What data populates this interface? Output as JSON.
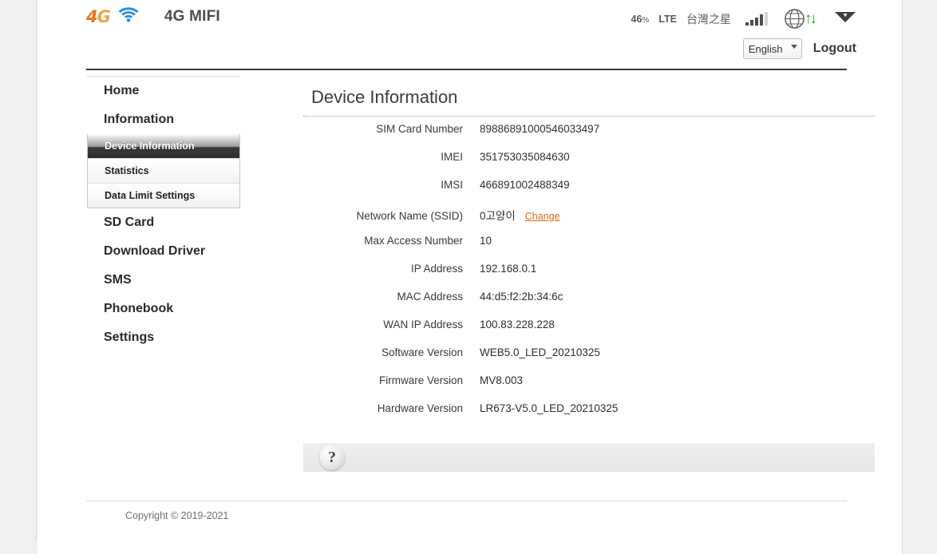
{
  "header": {
    "logo_digit": "4",
    "logo_letter": "G",
    "wifi_icon": "wifi-icon",
    "brand_title": "4G MIFI",
    "status": {
      "battery": "46",
      "battery_unit": "%",
      "network_type": "LTE",
      "carrier": "台灣之星",
      "signal_icon": "signal-bars-icon",
      "signal_bars_total": 5,
      "signal_bars_active": 4,
      "globe_icon": "globe-icon",
      "data_arrows_icon": "data-transfer-arrows-icon",
      "data_arrows_glyph": "↑↓",
      "wifi_status_icon": "wifi-signal-icon"
    },
    "language": {
      "selected": "English",
      "options": [
        "English"
      ],
      "caret_icon": "chevron-down-icon"
    },
    "logout_label": "Logout"
  },
  "sidebar": {
    "items": [
      {
        "label": "Home",
        "type": "top",
        "active": false
      },
      {
        "label": "Information",
        "type": "top",
        "active": false
      },
      {
        "label": "Device Information",
        "type": "sub",
        "active": true
      },
      {
        "label": "Statistics",
        "type": "sub",
        "active": false
      },
      {
        "label": "Data Limit Settings",
        "type": "sub",
        "active": false
      },
      {
        "label": "SD Card",
        "type": "top",
        "active": false
      },
      {
        "label": "Download Driver",
        "type": "top",
        "active": false
      },
      {
        "label": "SMS",
        "type": "top",
        "active": false
      },
      {
        "label": "Phonebook",
        "type": "top",
        "active": false
      },
      {
        "label": "Settings",
        "type": "top",
        "active": false
      }
    ]
  },
  "main": {
    "title": "Device Information",
    "rows": [
      {
        "label": "SIM Card Number",
        "value": "89886891000546033497"
      },
      {
        "label": "IMEI",
        "value": "351753035084630"
      },
      {
        "label": "IMSI",
        "value": "466891002488349"
      },
      {
        "label": "Network Name (SSID)",
        "value": "0고양이",
        "action": "Change"
      },
      {
        "label": "Max Access Number",
        "value": "10"
      },
      {
        "label": "IP Address",
        "value": "192.168.0.1"
      },
      {
        "label": "MAC Address",
        "value": "44:d5:f2:2b:34:6c"
      },
      {
        "label": "WAN IP Address",
        "value": "100.83.228.228"
      },
      {
        "label": "Software Version",
        "value": "WEB5.0_LED_20210325"
      },
      {
        "label": "Firmware Version",
        "value": "MV8.003"
      },
      {
        "label": "Hardware Version",
        "value": "LR673-V5.0_LED_20210325"
      }
    ],
    "help": {
      "icon": "question-mark-icon",
      "glyph": "?"
    }
  },
  "footer": {
    "copyright": "Copyright © 2019-2021"
  },
  "colors": {
    "logo_orange": "#e8751a",
    "wifi_blue": "#2f8fd8",
    "link_orange": "#d2691e",
    "arrows_green": "#18ab29",
    "active_nav": "#2e2e2e"
  }
}
